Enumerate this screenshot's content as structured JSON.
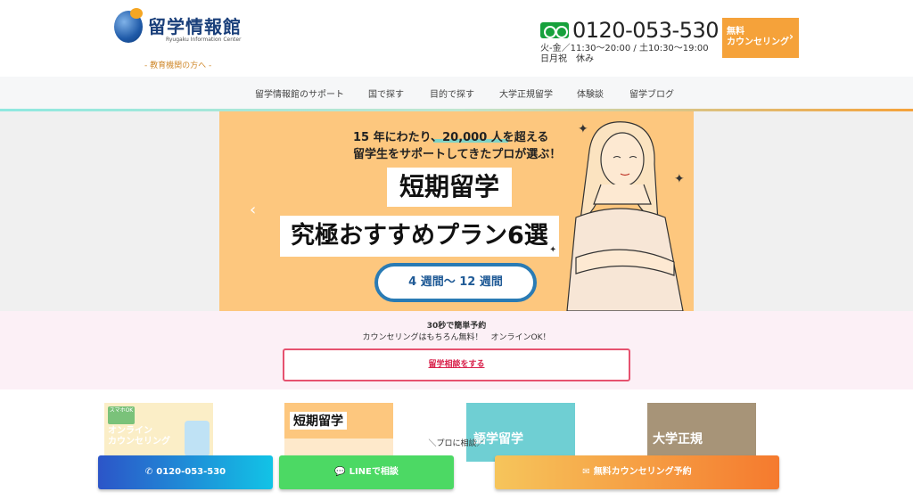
{
  "header": {
    "logo_title": "留学情報館",
    "logo_subtitle": "Ryugaku Information Center",
    "edu_link": "- 教育機関の方へ -",
    "phone": "0120-053-530",
    "hours_line1": "火-金／11:30〜20:00 / 土10:30〜19:00",
    "hours_line2": "日月祝　休み",
    "counsel_line1": "無料",
    "counsel_line2": "カウンセリング"
  },
  "nav": {
    "items": [
      "留学情報館のサポート",
      "国で探す",
      "目的で探す",
      "大学正規留学",
      "体験談",
      "留学ブログ"
    ]
  },
  "hero": {
    "line1": "15 年にわたり、20,000 人を超える",
    "line2": "留学生をサポートしてきたプロが選ぶ！",
    "title1": "短期留学",
    "title2": "究極おすすめプラン6選",
    "pill": "4 週間〜 12 週間",
    "prev_icon": "chevron-left"
  },
  "reserve": {
    "line1": "30秒で簡単予約",
    "line2": "カウンセリングはもちろん無料！　オンラインOK！",
    "button": "留学相談をする"
  },
  "cards": [
    {
      "label": "オンライン\nカウンセリング",
      "badge": "スマホOK"
    },
    {
      "label": "短期留学"
    },
    {
      "label": "語学留学"
    },
    {
      "label": "大学正規"
    }
  ],
  "cta": {
    "prompt": "＼プロに相談／",
    "phone": "0120-053-530",
    "line": "LINEで相談",
    "booking": "無料カウンセリング予約"
  },
  "colors": {
    "accent_orange": "#f5a23a",
    "brand_blue": "#1a3f7a",
    "reserve_pink": "#e6526f",
    "line_green": "#4cd964"
  }
}
